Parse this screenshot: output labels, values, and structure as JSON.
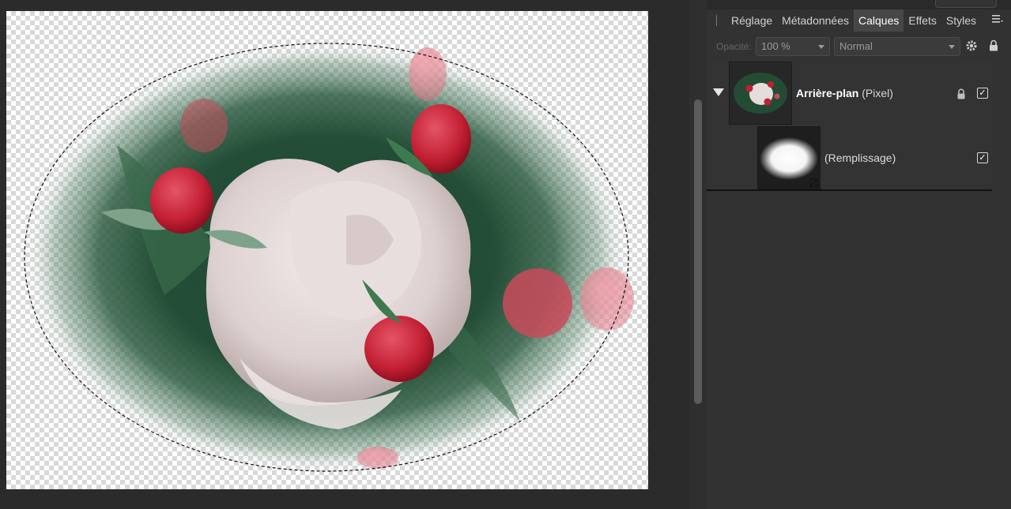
{
  "panel": {
    "tabs": [
      {
        "label": "Réglage",
        "active": false
      },
      {
        "label": "Métadonnées",
        "active": false
      },
      {
        "label": "Calques",
        "active": true
      },
      {
        "label": "Effets",
        "active": false
      },
      {
        "label": "Styles",
        "active": false
      }
    ],
    "menu_icon": "hamburger-menu-icon",
    "opacity_label": "Opacité:",
    "opacity_value": "100 %",
    "blend_mode": "Normal",
    "settings_icon": "gear-icon",
    "lock_icon": "lock-icon"
  },
  "layers": [
    {
      "name": "Arrière-plan",
      "type": "(Pixel)",
      "locked": true,
      "visible": true
    },
    {
      "name": "(Remplissage)",
      "visible": true
    }
  ],
  "colors": {
    "accent": "#474747",
    "panel_bg": "#323232",
    "workspace_bg": "#2b2b2b"
  }
}
